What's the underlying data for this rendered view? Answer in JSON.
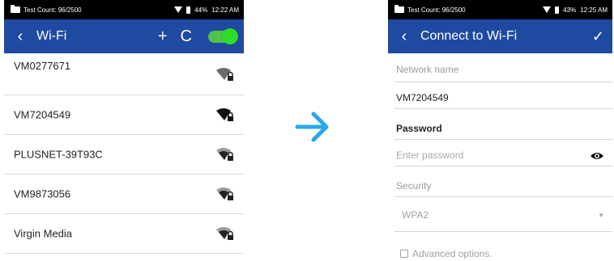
{
  "left": {
    "status": {
      "test_count": "Test Count: 96/2500",
      "battery": "44%",
      "time": "12:22 AM"
    },
    "appbar": {
      "back": "‹",
      "title": "Wi-Fi",
      "add": "+",
      "refresh": "C"
    },
    "networks": [
      {
        "name": "VM0277671"
      },
      {
        "name": "VM7204549"
      },
      {
        "name": "PLUSNET-39T93C"
      },
      {
        "name": "VM9873056"
      },
      {
        "name": "Virgin Media"
      }
    ]
  },
  "right": {
    "status": {
      "test_count": "Test Count: 96/2500",
      "battery": "43%",
      "time": "12:25 AM"
    },
    "appbar": {
      "back": "‹",
      "title": "Connect to Wi-Fi",
      "confirm": "✓"
    },
    "form": {
      "network_label": "Network name",
      "network_value": "VM7204549",
      "password_label": "Password",
      "password_placeholder": "Enter password",
      "security_label": "Security",
      "security_value": "WPA2",
      "advanced_label": "Advanced options."
    }
  },
  "colors": {
    "appbar": "#1f4aa1",
    "arrow": "#29a8e8",
    "toggle": "#2fdc2a"
  }
}
